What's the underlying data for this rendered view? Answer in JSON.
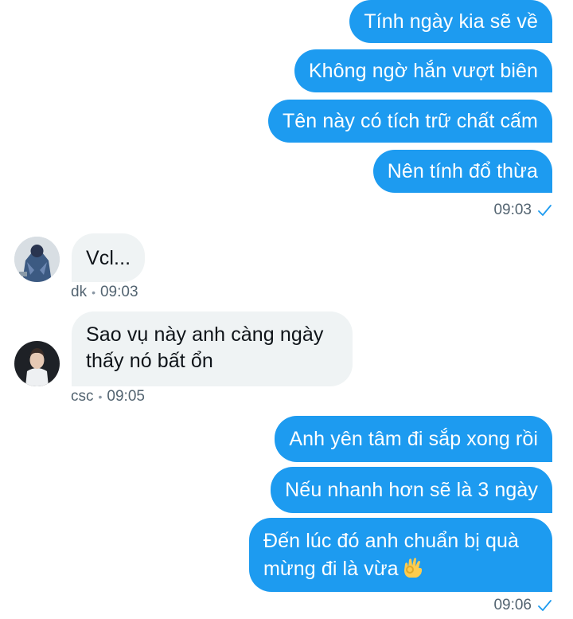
{
  "conversation": {
    "group1": {
      "messages": [
        "Tính ngày kia sẽ về",
        "Không ngờ hắn vượt biên",
        "Tên này có tích trữ chất cấm",
        "Nên tính đổ thừa"
      ],
      "time": "09:03"
    },
    "incoming1": {
      "text": "Vcl...",
      "sender": "dk",
      "time": "09:03"
    },
    "incoming2": {
      "text": "Sao vụ này anh càng ngày thấy nó bất ổn",
      "sender": "csc",
      "time": "09:05"
    },
    "group2": {
      "messages": [
        "Anh yên tâm đi sắp xong rồi",
        "Nếu nhanh hơn sẽ là 3 ngày",
        "Đến lúc đó anh chuẩn bị quà mừng đi là vừa"
      ],
      "time": "09:06"
    }
  },
  "separator": "•",
  "colors": {
    "outgoing_bubble": "#1d9bf0",
    "incoming_bubble": "#eff3f4",
    "meta_text": "#536471"
  },
  "icons": {
    "read_receipt": "checkmark-icon",
    "emoji": "ok-hand-emoji"
  }
}
